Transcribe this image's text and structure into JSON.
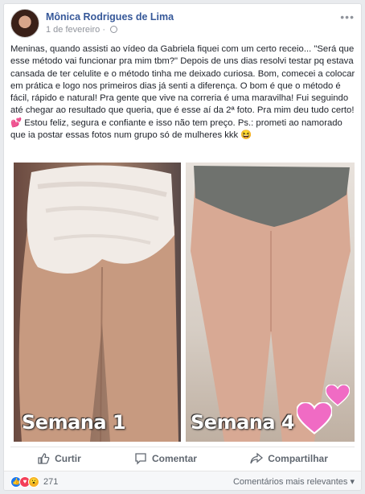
{
  "post": {
    "author": "Mônica Rodrigues de Lima",
    "date": "1 de fevereiro",
    "date_separator": "·",
    "more_label": "•••",
    "text": "Meninas, quando assisti ao vídeo da Gabriela fiquei com um certo receio... \"Será que esse método vai funcionar pra mim tbm?\" Depois de uns dias resolvi testar pq estava cansada de ter celulite e o método tinha me deixado curiosa. Bom, comecei a colocar em prática e logo nos primeiros dias já senti a diferença. O bom é que o método é fácil, rápido e natural! Pra gente que vive na correria é uma maravilha! Fui seguindo até chegar ao resultado que queria, que é esse aí da 2ª foto. Pra mim deu tudo certo! 💕 Estou feliz, segura e confiante e isso não tem preço. Ps.: prometi ao namorado que ia postar essas fotos num grupo só de mulheres kkk 😆"
  },
  "photos": {
    "left_caption": "Semana 1",
    "right_caption": "Semana 4"
  },
  "actions": {
    "like": "Curtir",
    "comment": "Comentar",
    "share": "Compartilhar"
  },
  "footer": {
    "reaction_count": "271",
    "sort_label": "Comentários mais relevantes ▾"
  },
  "colors": {
    "link_blue": "#365899",
    "like_blue": "#1877f2",
    "love_red": "#f33e58",
    "wow_yellow": "#f7b125"
  }
}
